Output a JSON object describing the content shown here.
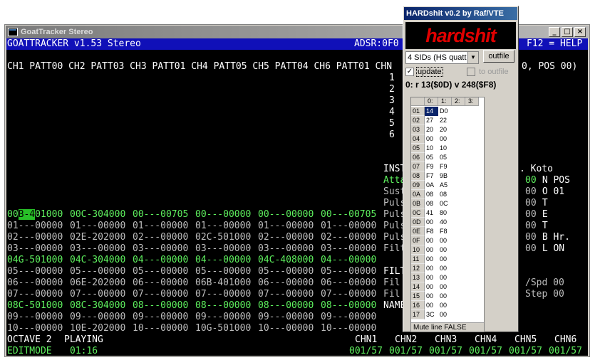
{
  "gt": {
    "window_title": "GoatTracker Stereo",
    "header_left": "GOATTRACKER v1.53 Stereo",
    "header_adsr": "ADSR:0F0",
    "header_help": "F12 = HELP",
    "channels_line": "CH1 PATT00 CH2 PATT03 CH3 PATT01 CH4 PATT05 CH5 PATT04 CH6 PATT01 CHN",
    "pos_frag": "0, POS 00)",
    "order_nums": [
      "1",
      "2",
      "3",
      "4",
      "5",
      "6"
    ],
    "pattern_rows": [
      {
        "color": "green",
        "text": "00B-401000 00C-304000 00---00705 00---00000 00---00000 00---00705"
      },
      {
        "color": "grey",
        "text": "01---00000 01---00000 01---00000 01---00000 01---00000 01---00000"
      },
      {
        "color": "grey",
        "text": "02---00000 02E-202000 02---00000 02C-501000 02---00000 02---00000"
      },
      {
        "color": "grey",
        "text": "03---00000 03---00000 03---00000 03---00000 03---00000 03---00000"
      },
      {
        "color": "green",
        "text": "04G-501000 04C-304000 04---00000 04---00000 04C-408000 04---00000"
      },
      {
        "color": "grey",
        "text": "05---00000 05---00000 05---00000 05---00000 05---00000 05---00000"
      },
      {
        "color": "grey",
        "text": "06---00000 06E-202000 06---00000 06B-401000 06---00000 06---00000"
      },
      {
        "color": "grey",
        "text": "07---00000 07---00000 07---00000 07---00000 07---00000 07---00000"
      },
      {
        "color": "green",
        "text": "08C-501000 08C-304000 08---00000 08---00000 08---00000 08---00000"
      },
      {
        "color": "grey",
        "text": "09---00000 09---00000 09---00000 09---00000 09---00000 09---00000"
      },
      {
        "color": "grey",
        "text": "10---00000 10E-202000 10---00000 10G-501000 10---00000 10---00000"
      }
    ],
    "instr_labels": [
      {
        "color": "white",
        "text": "INST"
      },
      {
        "color": "green",
        "text": "Atta"
      },
      {
        "color": "grey",
        "text": "Sust"
      },
      {
        "color": "grey",
        "text": "Puls"
      },
      {
        "color": "grey",
        "text": "Puls"
      },
      {
        "color": "grey",
        "text": "Puls"
      },
      {
        "color": "grey",
        "text": "Puls"
      },
      {
        "color": "grey",
        "text": "Filt"
      }
    ],
    "instr_right": [
      {
        "color": "white",
        "text": ". Koto"
      },
      {
        "color": "green",
        "text": "00",
        "tail": " N POS"
      },
      {
        "color": "grey",
        "text": "00",
        "tail": " O 01"
      },
      {
        "color": "grey",
        "text": "00",
        "tail": " T"
      },
      {
        "color": "grey",
        "text": "00",
        "tail": " E"
      },
      {
        "color": "grey",
        "text": "00",
        "tail": " T"
      },
      {
        "color": "grey",
        "text": "00",
        "tail": " B Hr."
      },
      {
        "color": "grey",
        "text": "00",
        "tail": " L ON"
      }
    ],
    "filter_labels": [
      {
        "color": "white",
        "text": "FILT"
      },
      {
        "color": "grey",
        "text": "Fil"
      },
      {
        "color": "grey",
        "text": "Fil"
      }
    ],
    "filter_right": [
      "/Spd 00",
      "Step 00"
    ],
    "name_label": "NAME",
    "footer_octave": "OCTAVE 2",
    "footer_state": "PLAYING",
    "footer_mode": "EDITMODE",
    "footer_time": "01:16",
    "footer_chn_labels": [
      "CHN1",
      "CHN2",
      "CHN3",
      "CHN4",
      "CHN5",
      "CHN6"
    ],
    "footer_chn_values": [
      "001/57",
      "001/57",
      "001/57",
      "001/57",
      "001/57",
      "001/57"
    ]
  },
  "hs": {
    "window_title": "HARDshit v0.2 by Raf/VTE",
    "logo_text": "hardshit",
    "sid_select_value": "4 SIDs (HS quatt",
    "outfile_button": "outfile",
    "update_label": "update",
    "update_checked": true,
    "to_outfile_label": "to outfile",
    "to_outfile_checked": false,
    "status_text": "0: r 13($0D) v 248($F8)",
    "grid_headers": [
      "",
      "0:",
      "1:",
      "2:",
      "3:"
    ],
    "grid_rows": [
      [
        "01",
        "14",
        "D0"
      ],
      [
        "02",
        "27",
        "22"
      ],
      [
        "03",
        "20",
        "20"
      ],
      [
        "04",
        "00",
        "00"
      ],
      [
        "05",
        "10",
        "10"
      ],
      [
        "06",
        "05",
        "05"
      ],
      [
        "07",
        "F9",
        "F9"
      ],
      [
        "08",
        "F7",
        "9B"
      ],
      [
        "09",
        "0A",
        "A5"
      ],
      [
        "0A",
        "08",
        "08"
      ],
      [
        "0B",
        "08",
        "0C"
      ],
      [
        "0C",
        "41",
        "80"
      ],
      [
        "0D",
        "00",
        "40"
      ],
      [
        "0E",
        "F8",
        "F8"
      ],
      [
        "0F",
        "00",
        "00"
      ],
      [
        "10",
        "00",
        "00"
      ],
      [
        "11",
        "00",
        "00"
      ],
      [
        "12",
        "00",
        "00"
      ],
      [
        "13",
        "00",
        "00"
      ],
      [
        "14",
        "00",
        "00"
      ],
      [
        "15",
        "00",
        "00"
      ],
      [
        "16",
        "00",
        "00"
      ],
      [
        "17",
        "3C",
        "00"
      ]
    ],
    "footer_text": "Mute line FALSE",
    "colors": {
      "logo_red": "#e00000",
      "selection_blue": "#0a246a"
    }
  }
}
